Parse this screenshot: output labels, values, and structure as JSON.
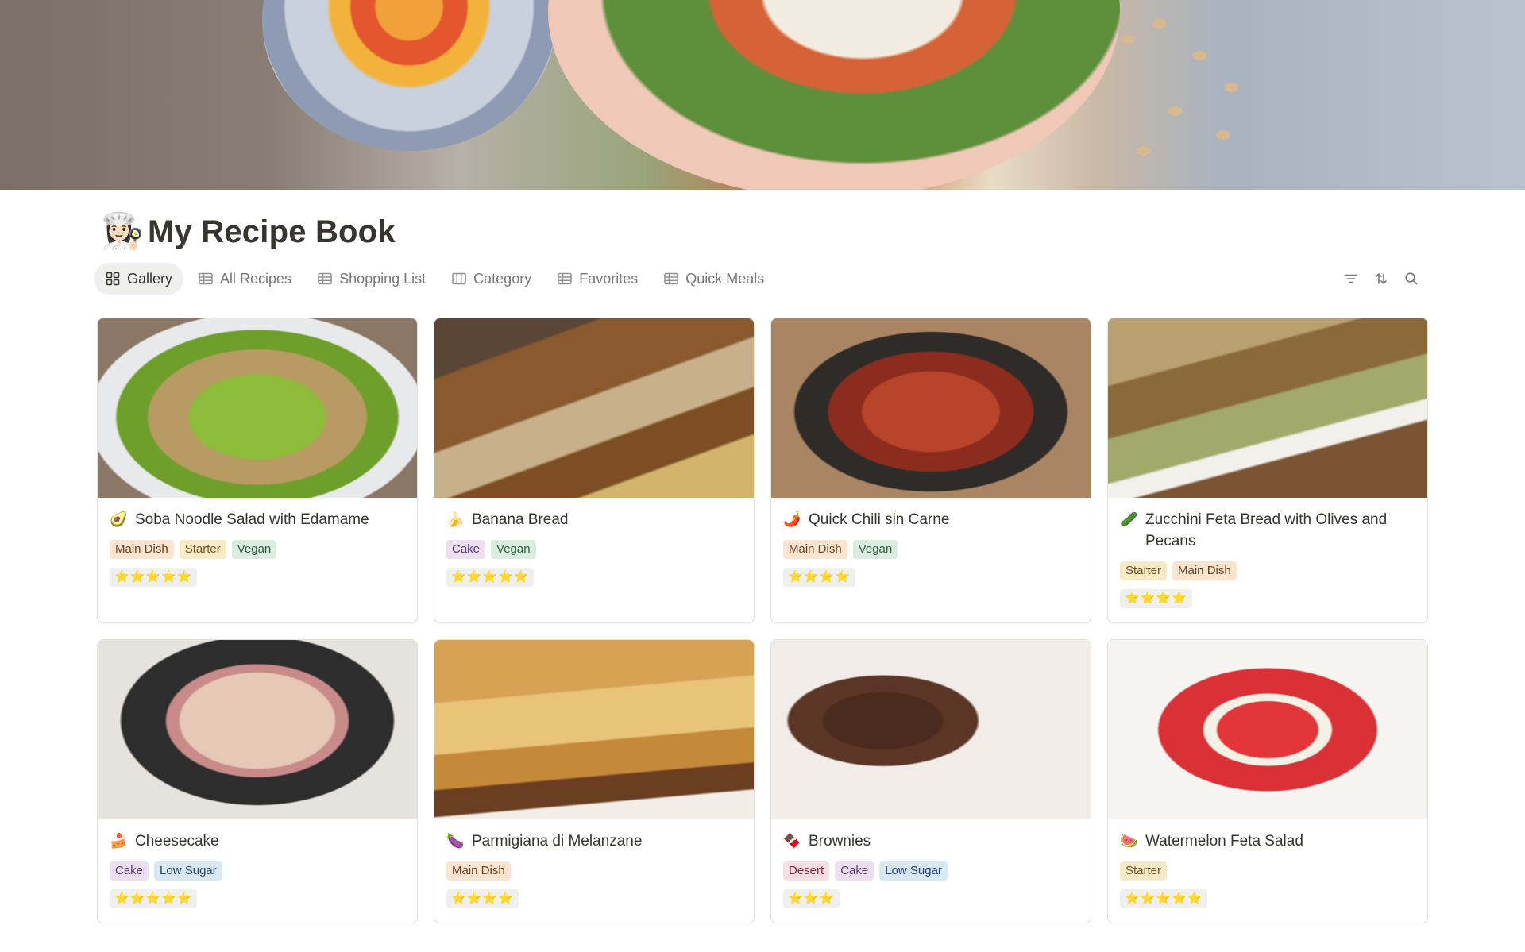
{
  "cover": {
    "icon": "food-cover-image"
  },
  "page": {
    "icon": "👩🏻‍🍳",
    "title": "My Recipe Book"
  },
  "tabs": [
    {
      "label": "Gallery",
      "icon": "gallery-grid-icon",
      "active": true
    },
    {
      "label": "All Recipes",
      "icon": "table-icon",
      "active": false
    },
    {
      "label": "Shopping List",
      "icon": "table-icon",
      "active": false
    },
    {
      "label": "Category",
      "icon": "board-icon",
      "active": false
    },
    {
      "label": "Favorites",
      "icon": "table-icon",
      "active": false
    },
    {
      "label": "Quick Meals",
      "icon": "table-icon",
      "active": false
    }
  ],
  "toolbar": {
    "filter_icon": "filter-icon",
    "sort_icon": "sort-icon",
    "search_icon": "search-icon"
  },
  "tag_colors": {
    "Main Dish": {
      "bg": "#fbe4d0",
      "fg": "#6b3f1d"
    },
    "Starter": {
      "bg": "#f7eac6",
      "fg": "#6f5322"
    },
    "Vegan": {
      "bg": "#dbede0",
      "fg": "#2c5a3a"
    },
    "Cake": {
      "bg": "#ecdff2",
      "fg": "#5a3a6b"
    },
    "Low Sugar": {
      "bg": "#d9e8f5",
      "fg": "#24466e"
    },
    "Desert": {
      "bg": "#f8dde3",
      "fg": "#7a2c40"
    }
  },
  "recipes": [
    {
      "emoji": "🥑",
      "title": "Soba Noodle Salad with Edamame",
      "tags": [
        "Main Dish",
        "Starter",
        "Vegan"
      ],
      "stars": "⭐⭐⭐⭐⭐",
      "image": "soba-noodle-salad"
    },
    {
      "emoji": "🍌",
      "title": "Banana Bread",
      "tags": [
        "Cake",
        "Vegan"
      ],
      "stars": "⭐⭐⭐⭐⭐",
      "image": "banana-bread"
    },
    {
      "emoji": "🌶️",
      "title": "Quick Chili sin Carne",
      "tags": [
        "Main Dish",
        "Vegan"
      ],
      "stars": "⭐⭐⭐⭐",
      "image": "chili-sin-carne"
    },
    {
      "emoji": "🥒",
      "title": "Zucchini Feta Bread with Olives and Pecans",
      "tags": [
        "Starter",
        "Main Dish"
      ],
      "stars": "⭐⭐⭐⭐",
      "image": "zucchini-feta-bread"
    },
    {
      "emoji": "🍰",
      "title": "Cheesecake",
      "tags": [
        "Cake",
        "Low Sugar"
      ],
      "stars": "⭐⭐⭐⭐⭐",
      "image": "cheesecake"
    },
    {
      "emoji": "🍆",
      "title": "Parmigiana di Melanzane",
      "tags": [
        "Main Dish"
      ],
      "stars": "⭐⭐⭐⭐",
      "image": "parmigiana"
    },
    {
      "emoji": "🍫",
      "title": "Brownies",
      "tags": [
        "Desert",
        "Cake",
        "Low Sugar"
      ],
      "stars": "⭐⭐⭐",
      "image": "brownies"
    },
    {
      "emoji": "🍉",
      "title": "Watermelon Feta Salad",
      "tags": [
        "Starter"
      ],
      "stars": "⭐⭐⭐⭐⭐",
      "image": "watermelon-feta-salad"
    }
  ]
}
